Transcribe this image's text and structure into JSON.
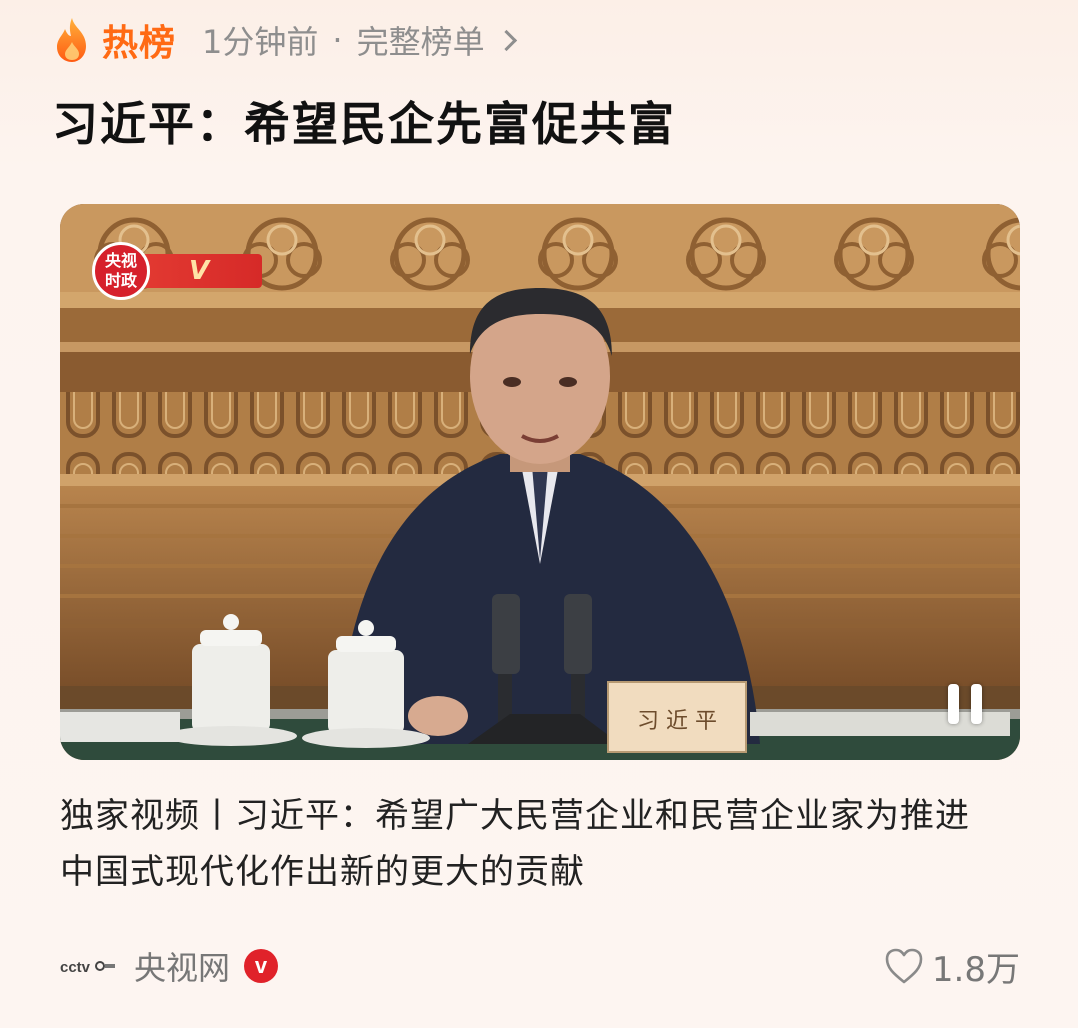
{
  "header": {
    "hot_label": "热榜",
    "time_ago": "1分钟前",
    "separator": "·",
    "full_list_link": "完整榜单"
  },
  "headline": "习近平：希望民企先富促共富",
  "video": {
    "badge_text": "央视\n时政",
    "badge_strip_text": "V",
    "nameplate_text": "习 近 平",
    "state": "playing"
  },
  "caption": "独家视频丨习近平：希望广大民营企业和民营企业家为推进中国式现代化作出新的更大的贡献",
  "footer": {
    "source_name": "央视网",
    "verified_mark": "v",
    "likes": "1.8万"
  },
  "colors": {
    "accent": "#ff6a14",
    "verified": "#e0222a",
    "meta_gray": "#8e8e8e"
  },
  "icons": [
    "flame-icon",
    "chevron-right-icon",
    "pause-icon",
    "cctv-logo-icon",
    "verified-icon",
    "heart-icon"
  ]
}
